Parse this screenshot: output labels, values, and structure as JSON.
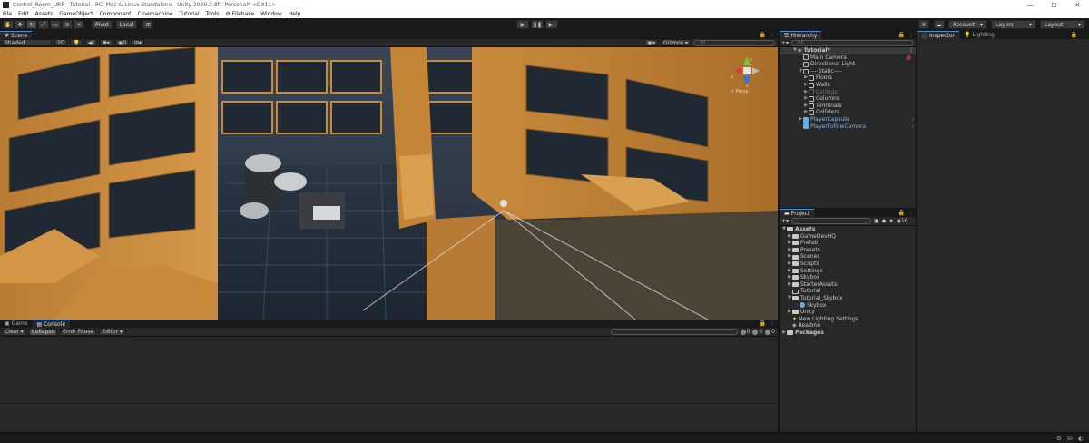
{
  "window": {
    "title": "Control_Room_URP - Tutorial - PC, Mac & Linux Standalone - Unity 2020.3.8f1 Personal* <DX11>",
    "controls": [
      "—",
      "☐",
      "✕"
    ]
  },
  "menu": [
    "File",
    "Edit",
    "Assets",
    "GameObject",
    "Component",
    "Cinemachine",
    "Tutorial",
    "Tools",
    "⚙ Filebase",
    "Window",
    "Help"
  ],
  "toolbar": {
    "pivot": "Pivot",
    "local": "Local",
    "account": "Account",
    "layers": "Layers",
    "layout": "Layout"
  },
  "scene": {
    "tab": "Scene",
    "shading": "Shaded",
    "mode_2d": "2D",
    "gizmos": "Gizmos",
    "search_placeholder": "All",
    "gizmo_axis_y": "y",
    "gizmo_axis_z": "z",
    "gizmo_axis_x": "x",
    "persp": "< Persp",
    "stat_eye": "0",
    "stat_count": "0"
  },
  "bottom_tabs": {
    "game": "Game",
    "console": "Console"
  },
  "console": {
    "clear": "Clear",
    "collapse": "Collapse",
    "error_pause": "Error Pause",
    "editor": "Editor",
    "info_count": "0",
    "warn_count": "0",
    "error_count": "0"
  },
  "hierarchy": {
    "tab": "Hierarchy",
    "search_placeholder": "All",
    "scene_name": "Tutorial*",
    "items": [
      "Main Camera",
      "Directional Light",
      "----Static----",
      "Floors",
      "Walls",
      "Ceilings",
      "Columns",
      "Terminals",
      "Colliders",
      "PlayerCapsule",
      "PlayerFollowCamera"
    ]
  },
  "project": {
    "tab": "Project",
    "hidden_count": "16",
    "assets_root": "Assets",
    "folders": [
      "GameDevHQ",
      "Prefab",
      "Presets",
      "Scenes",
      "Scripts",
      "Settings",
      "Skybox",
      "StarterAssets",
      "Tutorial",
      "Tutorial_Skybox",
      "Skybox",
      "Unity",
      "New Lighting Settings",
      "Readme"
    ],
    "packages_root": "Packages"
  },
  "inspector": {
    "tab_inspector": "Inspector",
    "tab_lighting": "Lighting"
  },
  "colors": {
    "accent": "#4a90d9",
    "prefab": "#7cb6f0",
    "wall_orange": "#c98a3c",
    "panel_dark": "#282828"
  }
}
